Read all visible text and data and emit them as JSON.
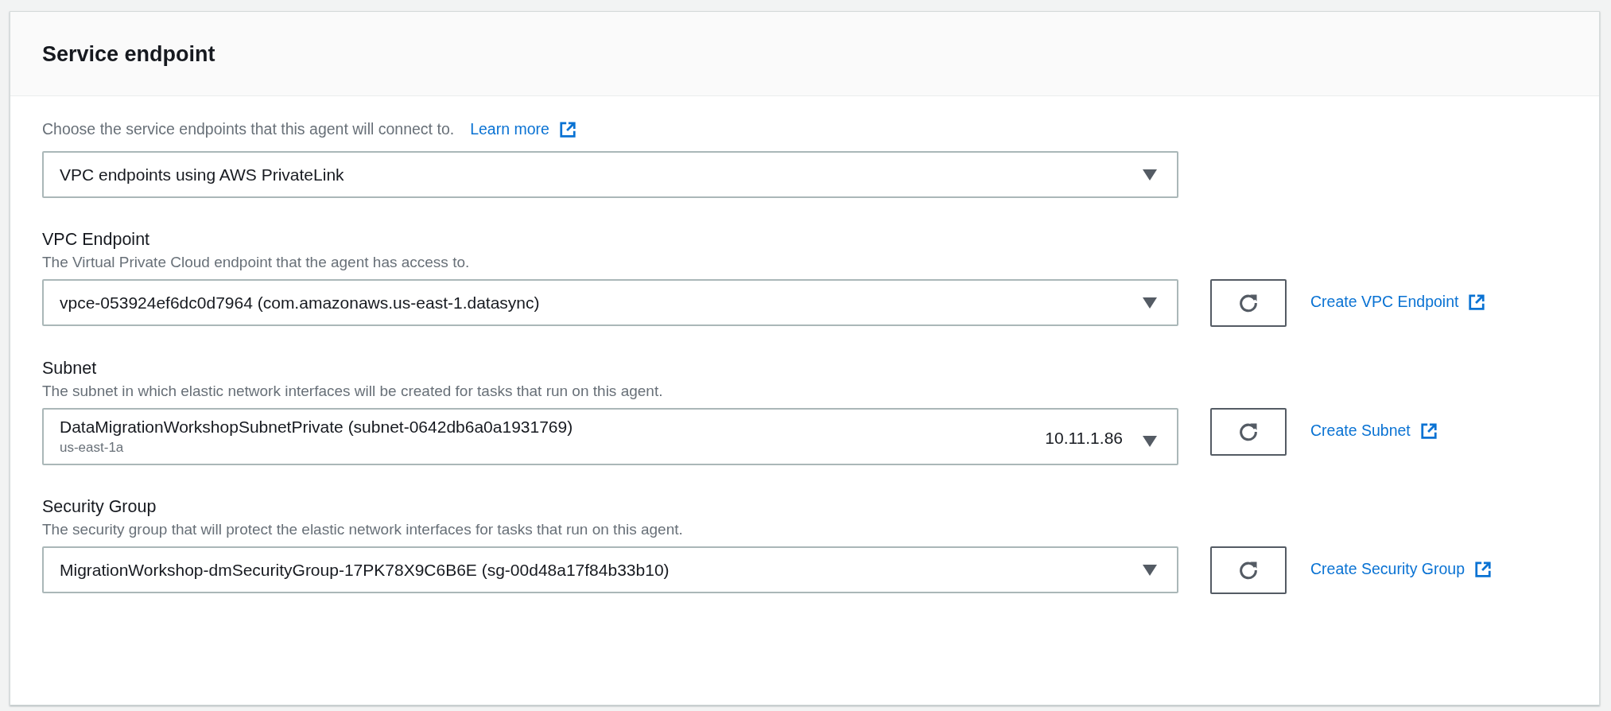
{
  "panel": {
    "title": "Service endpoint"
  },
  "intro": {
    "text": "Choose the service endpoints that this agent will connect to.",
    "link": "Learn more"
  },
  "endpoint_type": {
    "value": "VPC endpoints using AWS PrivateLink"
  },
  "fields": [
    {
      "label": "VPC Endpoint",
      "description": "The Virtual Private Cloud endpoint that the agent has access to.",
      "value": "vpce-053924ef6dc0d7964 (com.amazonaws.us-east-1.datasync)",
      "create_link": "Create VPC Endpoint"
    },
    {
      "label": "Subnet",
      "description": "The subnet in which elastic network interfaces will be created for tasks that run on this agent.",
      "value": "DataMigrationWorkshopSubnetPrivate (subnet-0642db6a0a1931769)",
      "secondary": "us-east-1a",
      "tag": "10.11.1.86",
      "create_link": "Create Subnet"
    },
    {
      "label": "Security Group",
      "description": "The security group that will protect the elastic network interfaces for tasks that run on this agent.",
      "value": "MigrationWorkshop-dmSecurityGroup-17PK78X9C6B6E (sg-00d48a17f84b33b10)",
      "create_link": "Create Security Group"
    }
  ]
}
